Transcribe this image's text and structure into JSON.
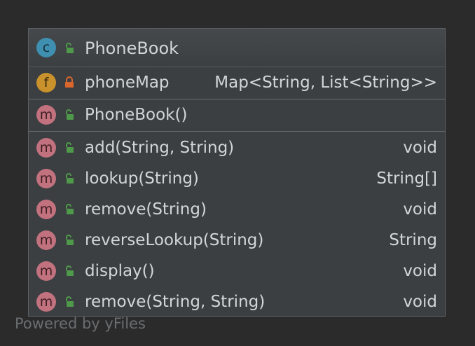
{
  "class_node": {
    "kind_badge": "c",
    "title": "PhoneBook"
  },
  "fields": [
    {
      "badge": "f",
      "visibility": "private",
      "name": "phoneMap",
      "type": "Map<String, List<String>>"
    }
  ],
  "constructors": [
    {
      "badge": "m",
      "visibility": "public",
      "name": "PhoneBook()",
      "type": ""
    }
  ],
  "methods": [
    {
      "badge": "m",
      "visibility": "public",
      "name": "add(String, String)",
      "type": "void"
    },
    {
      "badge": "m",
      "visibility": "public",
      "name": "lookup(String)",
      "type": "String[]"
    },
    {
      "badge": "m",
      "visibility": "public",
      "name": "remove(String)",
      "type": "void"
    },
    {
      "badge": "m",
      "visibility": "public",
      "name": "reverseLookup(String)",
      "type": "String"
    },
    {
      "badge": "m",
      "visibility": "public",
      "name": "display()",
      "type": "void"
    },
    {
      "badge": "m",
      "visibility": "public",
      "name": "remove(String, String)",
      "type": "void"
    }
  ],
  "watermark": "Powered by yFiles",
  "colors": {
    "background": "#2b2b2b",
    "node_fill": "#3b3f42",
    "class_badge": "#3e8fb0",
    "field_badge": "#c9922c",
    "method_badge": "#c2727e",
    "public_lock": "#4e9a4a",
    "private_lock": "#d9662c"
  }
}
